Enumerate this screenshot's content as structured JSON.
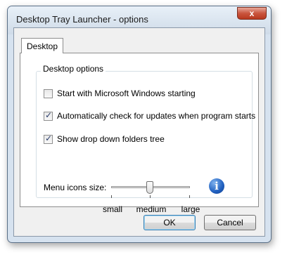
{
  "window": {
    "title": "Desktop Tray Launcher - options",
    "close_glyph": "x"
  },
  "tabs": [
    {
      "label": "Desktop",
      "selected": true
    }
  ],
  "group": {
    "label": "Desktop options"
  },
  "options": [
    {
      "label": "Start with Microsoft Windows starting",
      "checked": false
    },
    {
      "label": "Automatically check for updates when program starts",
      "checked": true
    },
    {
      "label": "Show drop down folders tree",
      "checked": true
    }
  ],
  "slider": {
    "label": "Menu icons size:",
    "labels": [
      "small",
      "medium",
      "large"
    ],
    "value": "medium"
  },
  "info_icon": {
    "glyph": "i",
    "icon": "info-icon"
  },
  "buttons": {
    "ok": "OK",
    "cancel": "Cancel"
  }
}
